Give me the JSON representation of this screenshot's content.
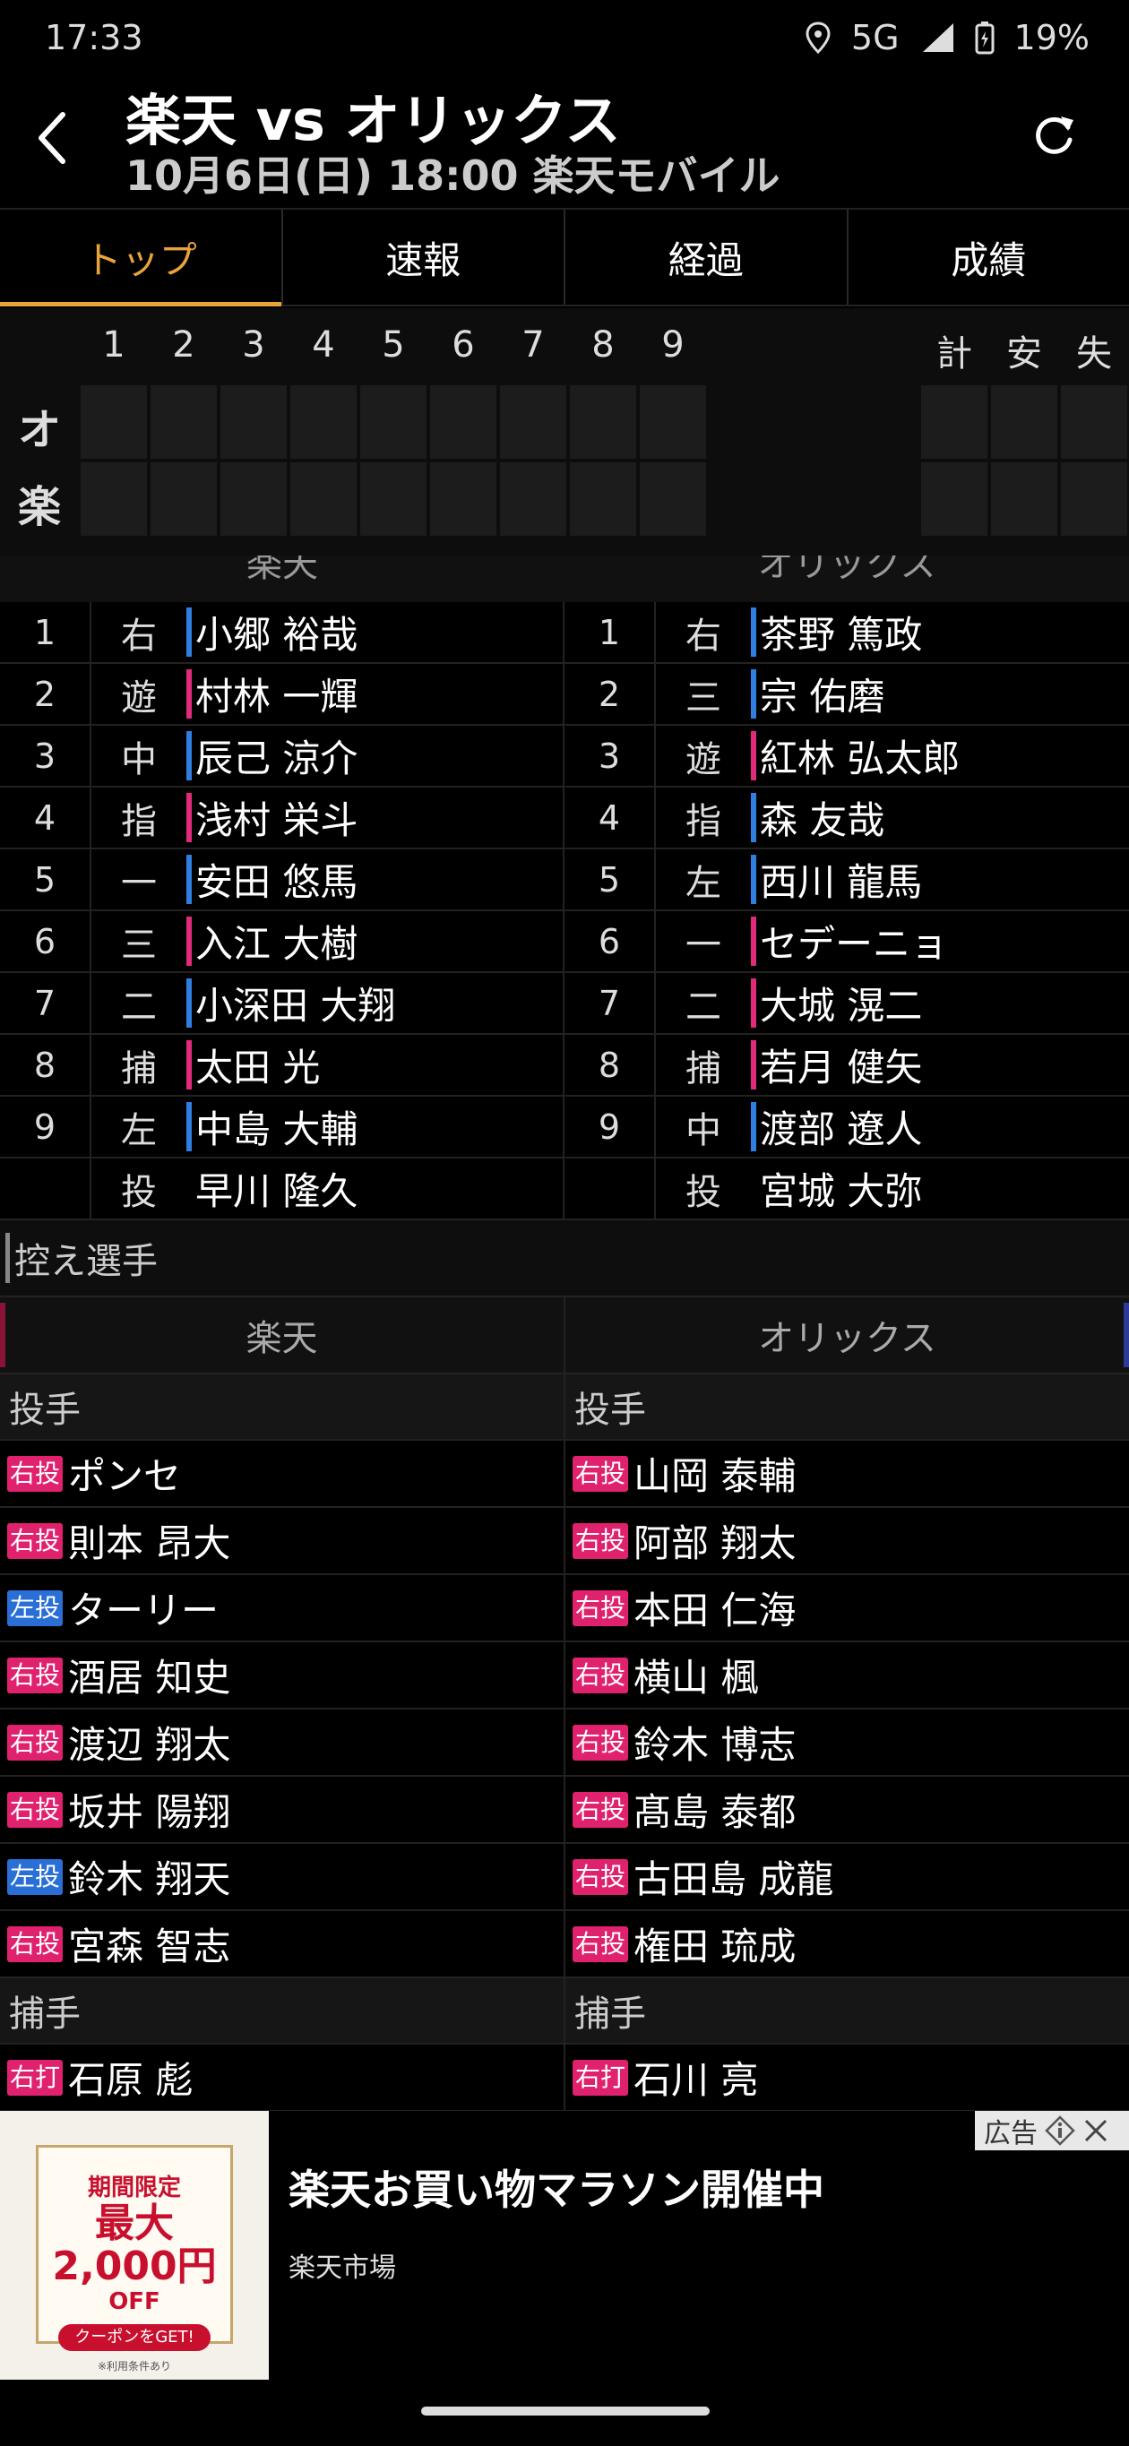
{
  "status": {
    "time": "17:33",
    "network": "5G",
    "battery": "19%"
  },
  "header": {
    "title": "楽天 vs オリックス",
    "subtitle": "10月6日(日) 18:00 楽天モバイル"
  },
  "tabs": [
    {
      "label": "トップ",
      "active": true
    },
    {
      "label": "速報"
    },
    {
      "label": "経過"
    },
    {
      "label": "成績"
    }
  ],
  "scoreboard": {
    "innings": [
      "1",
      "2",
      "3",
      "4",
      "5",
      "6",
      "7",
      "8",
      "9"
    ],
    "totals": [
      "計",
      "安",
      "失"
    ],
    "teams": [
      "オ",
      "楽"
    ]
  },
  "lineup": {
    "teams": {
      "home": "楽天",
      "away": "オリックス"
    },
    "rows": [
      {
        "n": "1",
        "hp": "右",
        "hname": "小郷 裕哉",
        "hbar": "blue",
        "ap": "右",
        "aname": "茶野 篤政",
        "abar": "blue"
      },
      {
        "n": "2",
        "hp": "遊",
        "hname": "村林 一輝",
        "hbar": "pink",
        "ap": "三",
        "aname": "宗 佑磨",
        "abar": "blue"
      },
      {
        "n": "3",
        "hp": "中",
        "hname": "辰己 涼介",
        "hbar": "blue",
        "ap": "遊",
        "aname": "紅林 弘太郎",
        "abar": "pink"
      },
      {
        "n": "4",
        "hp": "指",
        "hname": "浅村 栄斗",
        "hbar": "pink",
        "ap": "指",
        "aname": "森 友哉",
        "abar": "blue"
      },
      {
        "n": "5",
        "hp": "一",
        "hname": "安田 悠馬",
        "hbar": "blue",
        "ap": "左",
        "aname": "西川 龍馬",
        "abar": "blue"
      },
      {
        "n": "6",
        "hp": "三",
        "hname": "入江 大樹",
        "hbar": "pink",
        "ap": "一",
        "aname": "セデーニョ",
        "abar": "pink"
      },
      {
        "n": "7",
        "hp": "二",
        "hname": "小深田 大翔",
        "hbar": "blue",
        "ap": "二",
        "aname": "大城 滉二",
        "abar": "pink"
      },
      {
        "n": "8",
        "hp": "捕",
        "hname": "太田 光",
        "hbar": "pink",
        "ap": "捕",
        "aname": "若月 健矢",
        "abar": "pink"
      },
      {
        "n": "9",
        "hp": "左",
        "hname": "中島 大輔",
        "hbar": "blue",
        "ap": "中",
        "aname": "渡部 遼人",
        "abar": "blue"
      },
      {
        "n": "",
        "hp": "投",
        "hname": "早川 隆久",
        "hbar": "none",
        "ap": "投",
        "aname": "宮城 大弥",
        "abar": "none"
      }
    ]
  },
  "bench": {
    "section_title": "控え選手",
    "teams": {
      "home": "楽天",
      "away": "オリックス"
    },
    "pitcher_label": "投手",
    "catcher_label": "捕手",
    "pitchers": [
      {
        "hb": "右投",
        "hbt": "r",
        "hname": "ポンセ",
        "ab": "右投",
        "abt": "r",
        "aname": "山岡 泰輔"
      },
      {
        "hb": "右投",
        "hbt": "r",
        "hname": "則本 昂大",
        "ab": "右投",
        "abt": "r",
        "aname": "阿部 翔太"
      },
      {
        "hb": "左投",
        "hbt": "l",
        "hname": "ターリー",
        "ab": "右投",
        "abt": "r",
        "aname": "本田 仁海"
      },
      {
        "hb": "右投",
        "hbt": "r",
        "hname": "酒居 知史",
        "ab": "右投",
        "abt": "r",
        "aname": "横山 楓"
      },
      {
        "hb": "右投",
        "hbt": "r",
        "hname": "渡辺 翔太",
        "ab": "右投",
        "abt": "r",
        "aname": "鈴木 博志"
      },
      {
        "hb": "右投",
        "hbt": "r",
        "hname": "坂井 陽翔",
        "ab": "右投",
        "abt": "r",
        "aname": "髙島 泰都"
      },
      {
        "hb": "左投",
        "hbt": "l",
        "hname": "鈴木 翔天",
        "ab": "右投",
        "abt": "r",
        "aname": "古田島 成龍"
      },
      {
        "hb": "右投",
        "hbt": "r",
        "hname": "宮森 智志",
        "ab": "右投",
        "abt": "r",
        "aname": "権田 琉成"
      }
    ],
    "catchers": [
      {
        "hb": "右打",
        "hbt": "r",
        "hname": "石原 彪",
        "ab": "右打",
        "abt": "r",
        "aname": "石川 亮"
      }
    ]
  },
  "ad": {
    "title": "楽天お買い物マラソン開催中",
    "source": "楽天市場",
    "tag": "広告",
    "coupon": {
      "line1": "期間限定",
      "line2": "最大2,000円",
      "line3": "OFF",
      "button": "クーポンをGET!",
      "note": "※利用条件あり"
    }
  },
  "colors": {
    "accent": "#e8a33a",
    "right_badge": "#e0226e",
    "left_badge": "#2a6fd6"
  }
}
